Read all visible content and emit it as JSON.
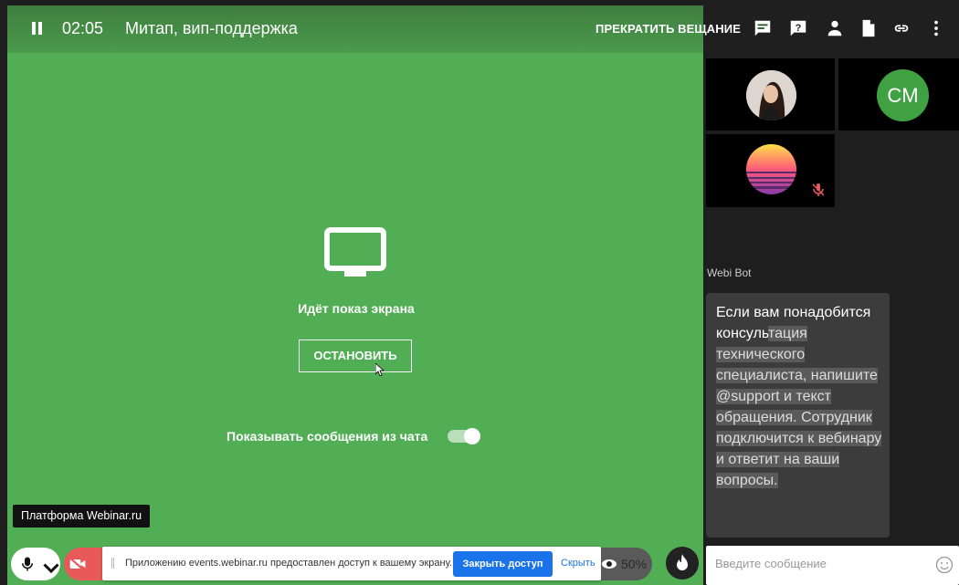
{
  "header": {
    "timer": "02:05",
    "title": "Митап, вип-поддержка",
    "stop_broadcast": "ПРЕКРАТИТЬ ВЕЩАНИЕ",
    "icons": [
      "chat-icon",
      "question-icon",
      "person-icon",
      "document-icon",
      "link-icon",
      "more-vert-icon"
    ]
  },
  "screen_share": {
    "status": "Идёт показ экрана",
    "stop_button": "ОСТАНОВИТЬ",
    "chat_toggle_label": "Показывать сообщения из чата",
    "chat_toggle_on": true
  },
  "tooltip": "Платформа Webinar.ru",
  "notification": {
    "text": "Приложению events.webinar.ru предоставлен доступ к вашему экрану.",
    "close_button": "Закрыть доступ",
    "hide_link": "Скрыть"
  },
  "controls": {
    "viewers_percent": "50%"
  },
  "participants": [
    {
      "type": "photo"
    },
    {
      "initials": "CM"
    },
    {
      "type": "sunset",
      "muted": true
    }
  ],
  "chat": {
    "author": "Webi Bot",
    "message_plain": "Если вам понадобится консуль",
    "message_highlighted": "тация технического специалиста, напишите @support и текст обращения. Сотрудник подключится к вебинару и ответит на ваши вопросы.",
    "input_placeholder": "Введите сообщение"
  },
  "colors": {
    "stage": "#52ae55",
    "cm_avatar": "#3fa142",
    "notif_button": "#1a73e8",
    "cam_off": "#e85a5a"
  }
}
